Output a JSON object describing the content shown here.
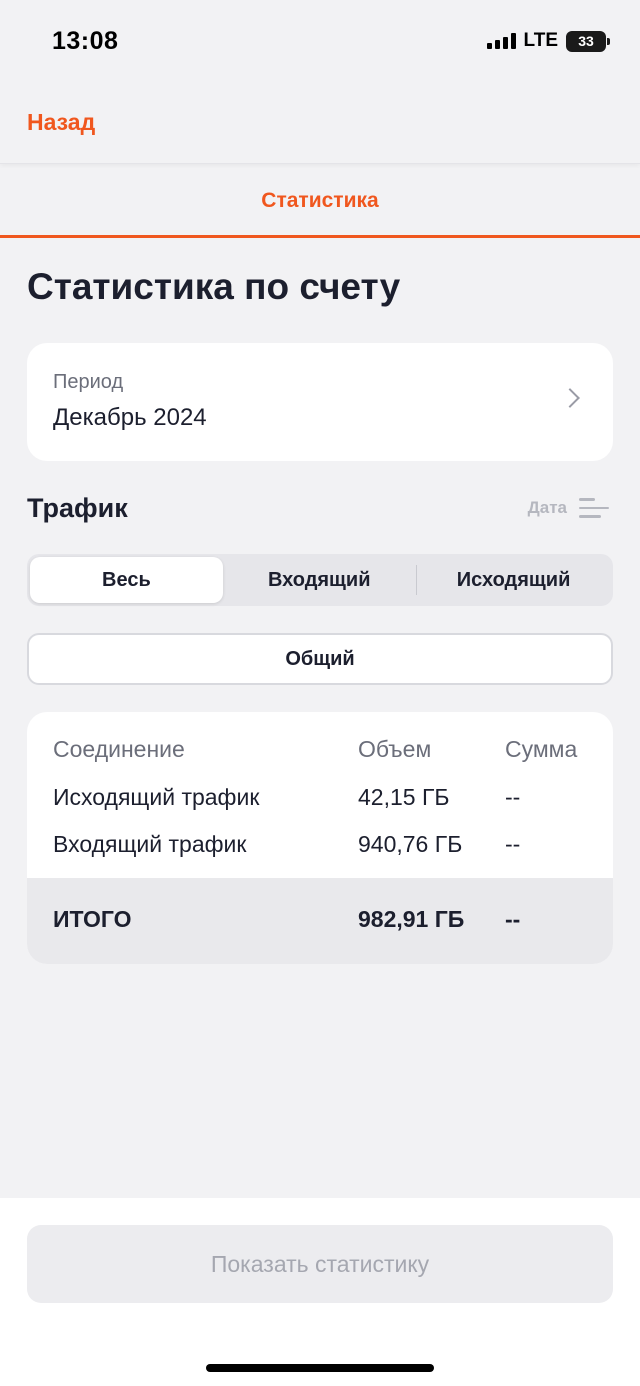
{
  "status_bar": {
    "time": "13:08",
    "network": "LTE",
    "battery": "33"
  },
  "nav": {
    "back_label": "Назад"
  },
  "tab": {
    "label": "Статистика"
  },
  "page": {
    "title": "Статистика по счету"
  },
  "period": {
    "label": "Период",
    "value": "Декабрь 2024"
  },
  "traffic": {
    "title": "Трафик",
    "sort_label": "Дата",
    "segments": [
      "Весь",
      "Входящий",
      "Исходящий"
    ],
    "active_segment": "Весь",
    "filter_label": "Общий"
  },
  "table": {
    "headers": [
      "Соединение",
      "Объем",
      "Сумма"
    ],
    "rows": [
      [
        "Исходящий трафик",
        "42,15 ГБ",
        "--"
      ],
      [
        "Входящий трафик",
        "940,76 ГБ",
        "--"
      ]
    ],
    "total": [
      "ИТОГО",
      "982,91 ГБ",
      "--"
    ]
  },
  "footer": {
    "button_label": "Показать статистику"
  },
  "colors": {
    "accent": "#f0571e",
    "background": "#f2f2f4",
    "text": "#1c1f2e"
  }
}
